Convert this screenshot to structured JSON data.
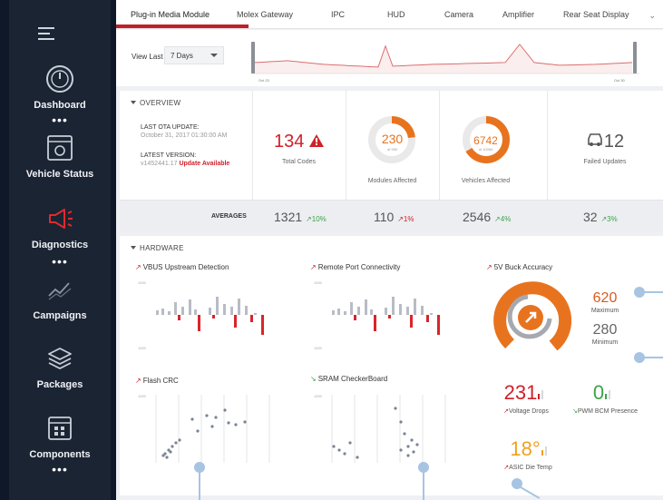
{
  "sidebar": {
    "items": [
      {
        "label": "Dashboard",
        "icon": "gauge-icon"
      },
      {
        "label": "Vehicle Status",
        "icon": "vehicle-status-icon"
      },
      {
        "label": "Diagnostics",
        "icon": "megaphone-icon",
        "active": true
      },
      {
        "label": "Campaigns",
        "icon": "trend-line-icon"
      },
      {
        "label": "Packages",
        "icon": "layers-icon"
      },
      {
        "label": "Components",
        "icon": "grid-icon"
      }
    ],
    "more_glyph": "•••"
  },
  "tabs": [
    "Plug-in Media Module",
    "Molex Gateway",
    "IPC",
    "HUD",
    "Camera",
    "Amplifier",
    "Rear Seat Display"
  ],
  "tabs_more": "⌄",
  "timeline": {
    "view_label": "View Last",
    "view_value": "7 Days",
    "start_label": "Oct 23",
    "end_label": "Oct 30"
  },
  "overview": {
    "title": "OVERVIEW",
    "ota_label": "LAST OTA UPDATE:",
    "ota_value": "October 31, 2017 01:30:00 AM",
    "version_label": "LATEST VERSION:",
    "version_value": "v1452441.17",
    "update_available": "Update Available",
    "total_codes": "134",
    "total_codes_label": "Total Codes",
    "modules_value": "230",
    "modules_of": "of 990",
    "modules_label": "Modules Affected",
    "vehicles_value": "6742",
    "vehicles_of": "of 10054",
    "vehicles_label": "Vehicles Affected",
    "failed_value": "12",
    "failed_label": "Failed Updates",
    "averages_label": "AVERAGES",
    "averages": [
      {
        "value": "1321",
        "pct": "10%",
        "dir": "up"
      },
      {
        "value": "110",
        "pct": "1%",
        "dir": "down"
      },
      {
        "value": "2546",
        "pct": "4%",
        "dir": "up"
      },
      {
        "value": "32",
        "pct": "3%",
        "dir": "up"
      }
    ],
    "colors": {
      "alert": "#d02028",
      "ring": "#e8731e",
      "ring_bg": "#e9e9ea"
    }
  },
  "hardware": {
    "title": "HARDWARE",
    "vbus_title": "VBUS Upstream Detection",
    "remote_title": "Remote Port Connectivity",
    "buck_title": "5V Buck Accuracy",
    "axis_top": "1000",
    "axis_bottom": "1000",
    "max_value": "620",
    "max_label": "Maximum",
    "min_value": "280",
    "min_label": "Minimum",
    "flash_title": "Flash CRC",
    "sram_title": "SRAM CheckerBoard",
    "voltage_value": "231",
    "voltage_label": "Voltage Drops",
    "pwm_value": "0",
    "pwm_label": "PWM BCM Presence",
    "asic_value": "18°",
    "asic_label": "ASIC Die Temp"
  }
}
